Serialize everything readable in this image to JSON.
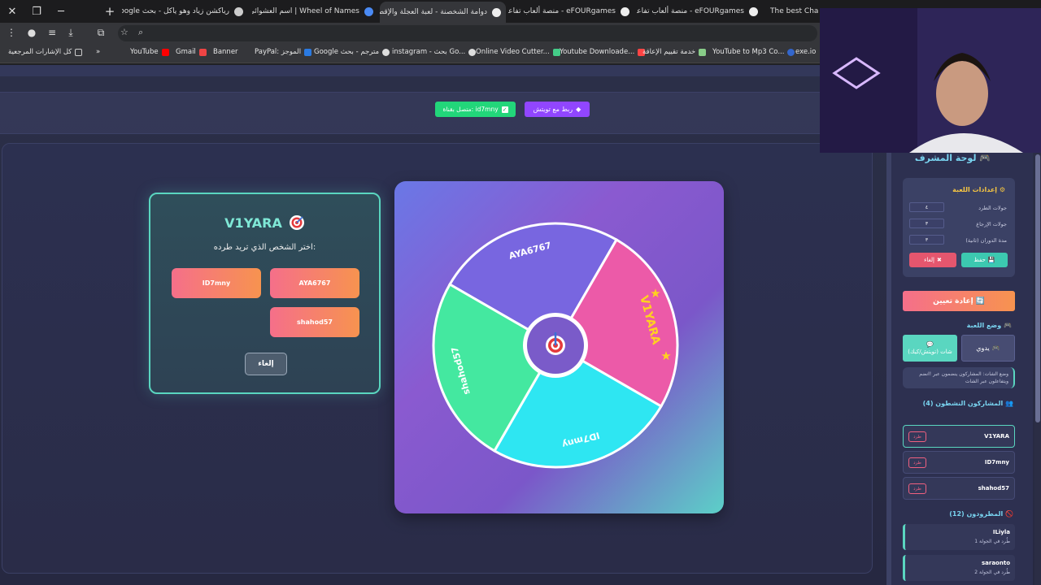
{
  "tabs": [
    {
      "title": "رياكشن زياد وهو ياكل - بحث Google",
      "close": "×"
    },
    {
      "title": "Wheel of Names | اسم العشوائي",
      "close": "×"
    },
    {
      "title": "دوامة الشخصنة - لعبة العجلة والإقصاء",
      "close": "×"
    },
    {
      "title": "eFOURgames - منصة ألعاب تفاعلي",
      "close": "×"
    },
    {
      "title": "eFOURgames - منصة ألعاب تفاعلي",
      "close": "×"
    },
    {
      "title": "The best Cha",
      "close": "×"
    }
  ],
  "window": {
    "close": "✕",
    "restore": "❐",
    "minimize": "─",
    "new_tab": "+"
  },
  "bookmarks": [
    {
      "label": "كل الإشارات المرجعية"
    },
    {
      "label": "»"
    },
    {
      "label": "YouTube"
    },
    {
      "label": "Gmail"
    },
    {
      "label": "Banner"
    },
    {
      "label": "PayPal: الموجز"
    },
    {
      "label": "Google مترجم - بحث"
    },
    {
      "label": "instagram - بحث Go..."
    },
    {
      "label": "Online Video Cutter..."
    },
    {
      "label": "Youtube Downloade..."
    },
    {
      "label": "خدمة تقييم الإعاقة"
    },
    {
      "label": "YouTube to Mp3 Co..."
    },
    {
      "label": "exe.io"
    }
  ],
  "header": {
    "twitch_button": "ربط مع تويتش",
    "connected_badge": "متصل بقناة: id7mny"
  },
  "modal": {
    "title": "V1YARA",
    "prompt": "اختر الشخص الذي تريد طرده:",
    "options": [
      "ID7mny",
      "AYA6767",
      "shahod57"
    ],
    "cancel": "إلغاء"
  },
  "wheel": {
    "segments": [
      {
        "name": "AYA6767",
        "color": "#7866e0"
      },
      {
        "name": "V1YARA",
        "color": "#ec5aa8"
      },
      {
        "name": "ID7mny",
        "color": "#2ee6f2"
      },
      {
        "name": "shahod57",
        "color": "#44e8a0"
      }
    ]
  },
  "sidebar": {
    "title": "لوحة المشرف",
    "settings_title": "إعدادات اللعبة",
    "settings": [
      {
        "label": "جولات الطرد",
        "value": "٤"
      },
      {
        "label": "جولات الإرجاع",
        "value": "٣"
      },
      {
        "label": "مدة الدوران (ثانية)",
        "value": "٣"
      }
    ],
    "save": "حفظ",
    "cancel": "إلغاء",
    "reset": "إعادة تعيين",
    "mode_title": "وضع اللعبة",
    "mode_manual": "يدوي",
    "mode_chat": "شات (تويتش/كيك)",
    "mode_note": "وضع الشات: المشاركون ينضمون عبر !انضم ويتفاعلون عبر الشات",
    "active_title": "المشاركون النشطون (4)",
    "active": [
      {
        "name": "V1YARA",
        "kick": "طرد"
      },
      {
        "name": "ID7mny",
        "kick": "طرد"
      },
      {
        "name": "shahod57",
        "kick": "طرد"
      }
    ],
    "eliminated_title": "المطرودون (12)",
    "eliminated": [
      {
        "name": "ILiyla",
        "status": "طُرد في الجولة 1"
      },
      {
        "name": "saraonto",
        "status": "طُرد في الجولة 2"
      }
    ]
  }
}
